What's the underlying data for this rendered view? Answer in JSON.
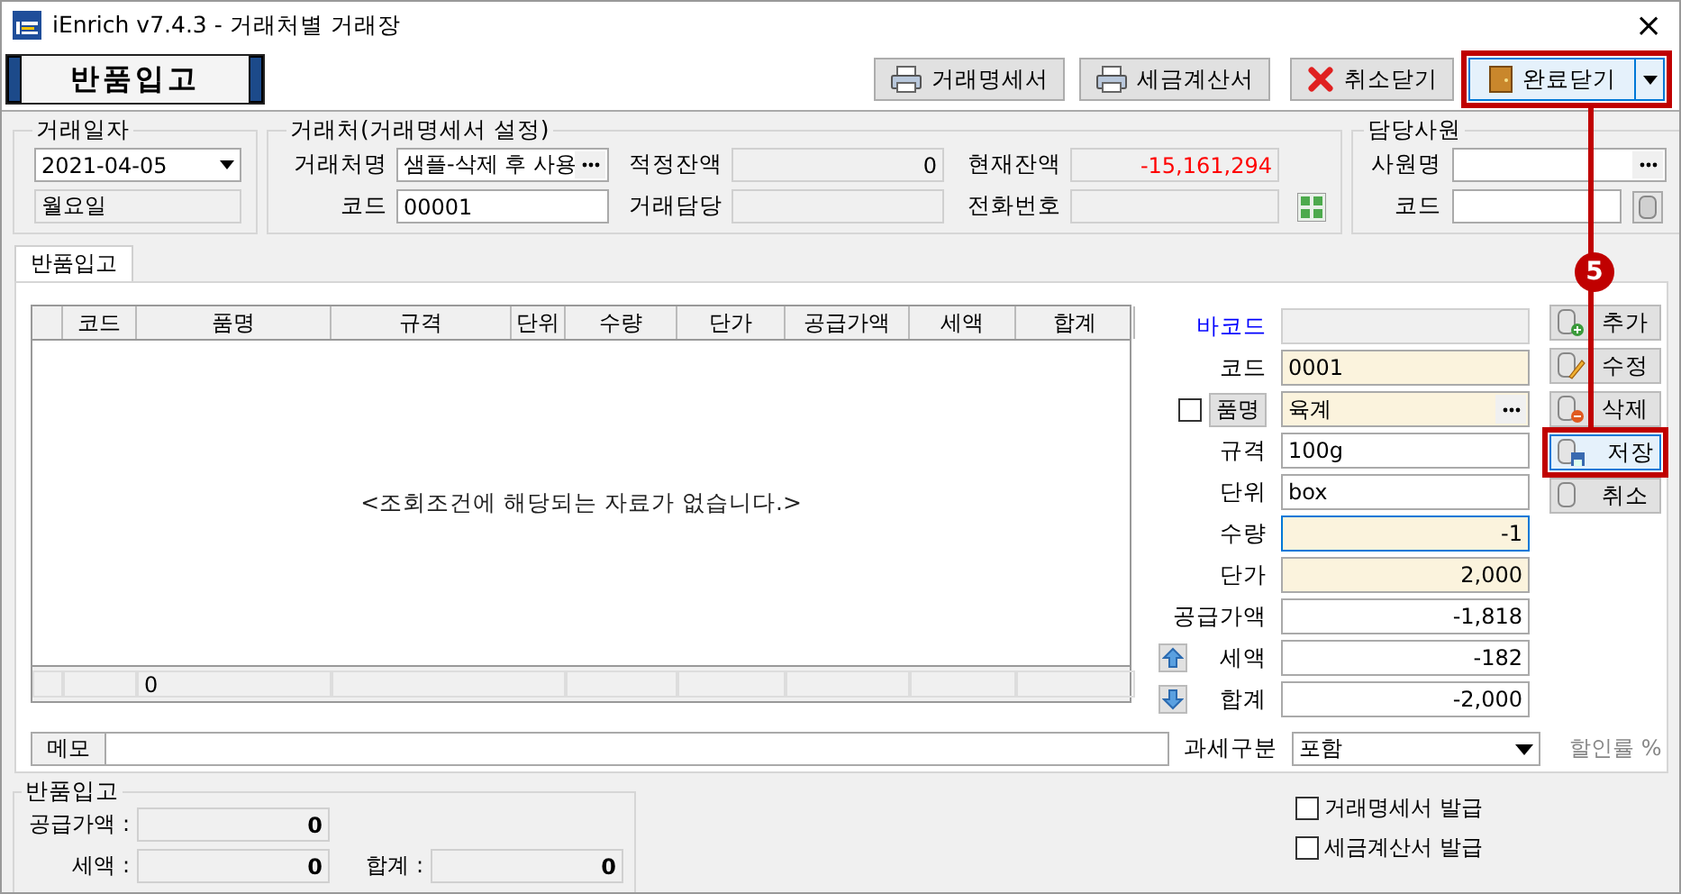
{
  "window": {
    "title": "iEnrich v7.4.3 - 거래처별 거래장",
    "close": "×"
  },
  "banner": "반품입고",
  "toolbar": [
    {
      "label": "거래명세서",
      "kind": "print",
      "annotated": false
    },
    {
      "label": "세금계산서",
      "kind": "print",
      "annotated": false
    },
    {
      "label": "취소닫기",
      "kind": "cancel",
      "annotated": false
    },
    {
      "label": "완료닫기",
      "kind": "done",
      "annotated": true
    }
  ],
  "date_group": {
    "title": "거래일자",
    "date": "2021-04-05",
    "weekday": "월요일"
  },
  "client_group": {
    "title": "거래처(거래명세서 설정)",
    "fields": [
      {
        "label": "거래처명",
        "value": "샘플-삭제 후 사용",
        "readonly": false,
        "browse": true,
        "negative": false
      },
      {
        "label": "적정잔액",
        "value": "0",
        "readonly": true,
        "browse": false,
        "negative": false
      },
      {
        "label": "현재잔액",
        "value": "-15,161,294",
        "readonly": true,
        "browse": false,
        "negative": true
      },
      {
        "label": "코드",
        "value": "00001",
        "readonly": false,
        "browse": false,
        "negative": false
      },
      {
        "label": "거래담당",
        "readonly": true,
        "browse": false,
        "negative": false
      },
      {
        "label": "전화번호",
        "readonly": true,
        "browse": false,
        "negative": false
      }
    ]
  },
  "staff_group": {
    "title": "담당사원",
    "name_label": "사원명",
    "code_label": "코드"
  },
  "tabs": [
    {
      "label": "반품입고",
      "selected": true
    }
  ],
  "grid": {
    "columns": [
      "코드",
      "품명",
      "규격",
      "단위",
      "수량",
      "단가",
      "공급가액",
      "세액",
      "합계"
    ],
    "empty_message": "<조회조건에 해당되는 자료가 없습니다.>",
    "footer_count": "0"
  },
  "form": [
    {
      "label": "바코드",
      "kind": "barcode",
      "required": false,
      "focused": false
    },
    {
      "label": "코드",
      "value": "0001",
      "kind": "text",
      "required": true,
      "focused": false
    },
    {
      "label": "품명",
      "value": "육계",
      "kind": "item",
      "checked": false,
      "required": true,
      "focused": false
    },
    {
      "label": "규격",
      "value": "100g",
      "kind": "text",
      "required": false,
      "focused": false
    },
    {
      "label": "단위",
      "value": "box",
      "kind": "text",
      "required": false,
      "focused": false
    },
    {
      "label": "수량",
      "value": "-1",
      "kind": "number",
      "required": true,
      "focused": true
    },
    {
      "label": "단가",
      "value": "2,000",
      "kind": "number",
      "required": true,
      "focused": false
    },
    {
      "label": "공급가액",
      "value": "-1,818",
      "kind": "number",
      "required": false,
      "focused": false
    },
    {
      "label": "세액",
      "value": "-182",
      "kind": "number",
      "up_button": true,
      "required": false,
      "focused": false
    },
    {
      "label": "합계",
      "value": "-2,000",
      "kind": "number",
      "down_button": true,
      "required": false,
      "focused": false
    }
  ],
  "side_buttons": [
    {
      "label": "추가",
      "kind": "add",
      "selected": false
    },
    {
      "label": "수정",
      "kind": "edit",
      "selected": false
    },
    {
      "label": "삭제",
      "kind": "delete",
      "selected": false
    },
    {
      "label": "저장",
      "kind": "save",
      "selected": true
    },
    {
      "label": "취소",
      "kind": "cancel",
      "selected": false
    }
  ],
  "memo": {
    "label": "메모"
  },
  "tax": {
    "label": "과세구분",
    "value": "포함",
    "discount": "할인률 %"
  },
  "summary": {
    "title": "반품입고",
    "supply_label": "공급가액 :",
    "supply": "0",
    "tax_label": "세액 :",
    "tax": "0",
    "total_label": "합계 :",
    "total": "0"
  },
  "checkboxes": [
    {
      "label": "거래명세서 발급",
      "checked": false
    },
    {
      "label": "세금계산서 발급",
      "checked": false
    }
  ],
  "annotation": {
    "number": "5"
  }
}
